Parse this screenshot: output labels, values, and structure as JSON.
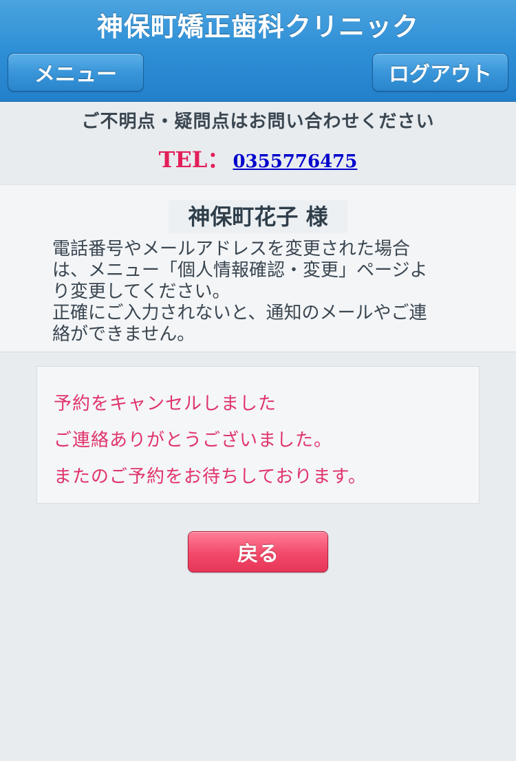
{
  "header": {
    "title": "神保町矯正歯科クリニック",
    "menu_label": "メニュー",
    "logout_label": "ログアウト"
  },
  "contact": {
    "note": "ご不明点・疑問点はお問い合わせください",
    "tel_label": "TEL：",
    "tel_number": "0355776475"
  },
  "user": {
    "name": "神保町花子 様",
    "notice_lines": [
      "電話番号やメールアドレスを変更された場合",
      "は、メニュー「個人情報確認・変更」ページよ",
      "り変更してください。",
      "正確にご入力されないと、通知のメールやご連",
      "絡ができません。"
    ]
  },
  "result": {
    "lines": [
      "予約をキャンセルしました",
      "ご連絡ありがとうございました。",
      "またのご予約をお待ちしております。"
    ]
  },
  "back_label": "戻る",
  "colors": {
    "header_blue": "#2e8fd6",
    "accent_pink": "#e31f5a",
    "link_blue": "#0000cc",
    "button_pink": "#f2496a"
  }
}
